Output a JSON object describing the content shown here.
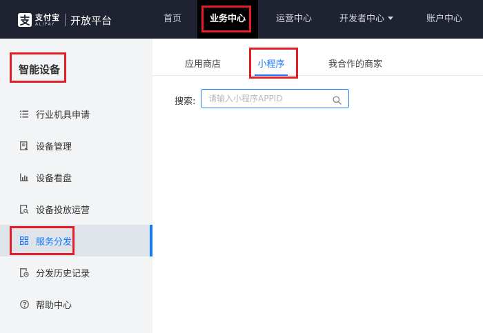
{
  "header": {
    "logo_cn": "支付宝",
    "logo_en": "ALIPAY",
    "platform_title": "开放平台",
    "nav": [
      {
        "label": "首页"
      },
      {
        "label": "业务中心"
      },
      {
        "label": "运营中心"
      },
      {
        "label": "开发者中心"
      },
      {
        "label": "账户中心"
      }
    ]
  },
  "sidebar": {
    "title": "智能设备",
    "items": [
      {
        "label": "行业机具申请",
        "icon": "list-icon"
      },
      {
        "label": "设备管理",
        "icon": "document-icon"
      },
      {
        "label": "设备看盘",
        "icon": "bar-chart-icon"
      },
      {
        "label": "设备投放运营",
        "icon": "document-search-icon"
      },
      {
        "label": "服务分发",
        "icon": "grid-icon"
      },
      {
        "label": "分发历史记录",
        "icon": "history-doc-icon"
      },
      {
        "label": "帮助中心",
        "icon": "help-icon"
      }
    ],
    "active_index": 4
  },
  "main": {
    "tabs": [
      {
        "label": "应用商店"
      },
      {
        "label": "小程序"
      },
      {
        "label": "我合作的商家"
      }
    ],
    "active_tab": 1,
    "search": {
      "label": "搜索:",
      "placeholder": "请输入小程序APPID",
      "value": ""
    }
  },
  "colors": {
    "header_bg": "#1f2230",
    "accent": "#1677ff",
    "highlight_box": "#e41e26"
  }
}
